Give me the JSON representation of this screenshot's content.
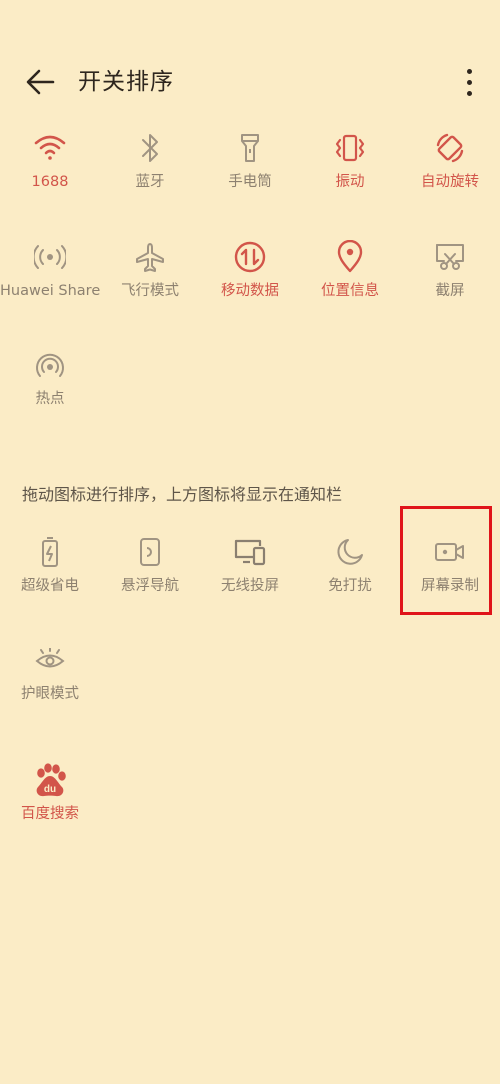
{
  "header": {
    "title": "开关排序"
  },
  "active_section": {
    "rows": [
      [
        {
          "label": "1688",
          "icon": "wifi-icon",
          "state": "on"
        },
        {
          "label": "蓝牙",
          "icon": "bluetooth-icon",
          "state": "off"
        },
        {
          "label": "手电筒",
          "icon": "flashlight-icon",
          "state": "off"
        },
        {
          "label": "振动",
          "icon": "vibrate-icon",
          "state": "on"
        },
        {
          "label": "自动旋转",
          "icon": "auto-rotate-icon",
          "state": "on"
        }
      ],
      [
        {
          "label": "Huawei Share",
          "icon": "huawei-share-icon",
          "state": "off"
        },
        {
          "label": "飞行模式",
          "icon": "airplane-icon",
          "state": "off"
        },
        {
          "label": "移动数据",
          "icon": "mobile-data-icon",
          "state": "on"
        },
        {
          "label": "位置信息",
          "icon": "location-icon",
          "state": "on"
        },
        {
          "label": "截屏",
          "icon": "screenshot-icon",
          "state": "off"
        }
      ],
      [
        {
          "label": "热点",
          "icon": "hotspot-icon",
          "state": "off"
        }
      ]
    ]
  },
  "hint_text": "拖动图标进行排序，上方图标将显示在通知栏",
  "inactive_section": {
    "rows": [
      [
        {
          "label": "超级省电",
          "icon": "battery-saver-icon",
          "state": "off"
        },
        {
          "label": "悬浮导航",
          "icon": "floating-nav-icon",
          "state": "off"
        },
        {
          "label": "无线投屏",
          "icon": "wireless-projection-icon",
          "state": "off"
        },
        {
          "label": "免打扰",
          "icon": "do-not-disturb-icon",
          "state": "off"
        },
        {
          "label": "屏幕录制",
          "icon": "screen-record-icon",
          "state": "off"
        }
      ],
      [
        {
          "label": "护眼模式",
          "icon": "eye-comfort-icon",
          "state": "off"
        }
      ],
      [
        {
          "label": "百度搜索",
          "icon": "baidu-icon",
          "state": "on"
        }
      ]
    ]
  },
  "colors": {
    "background": "#fbecc6",
    "accent": "#d2554a",
    "inactive": "#8d8170",
    "highlight_box": "#e0141a"
  }
}
